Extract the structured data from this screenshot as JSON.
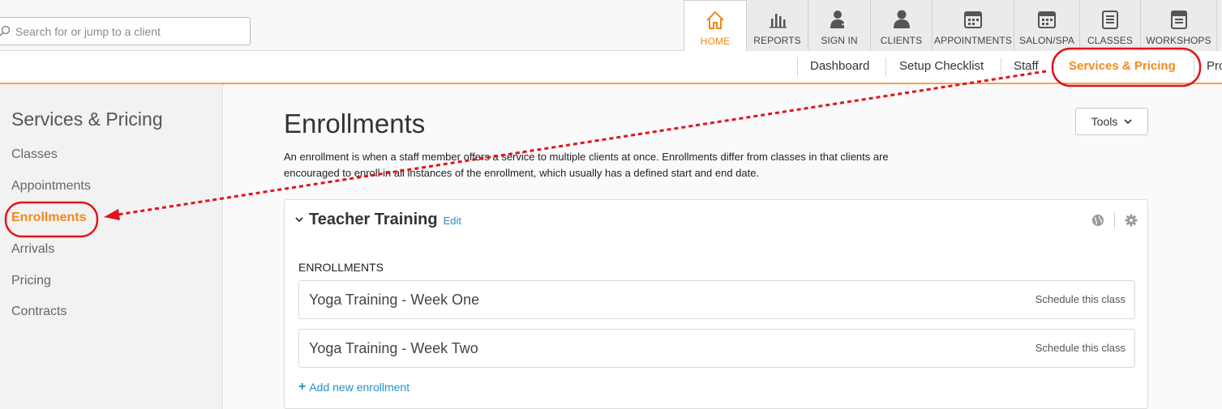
{
  "search": {
    "placeholder": "Search for or jump to a client"
  },
  "nav_tabs": [
    {
      "label": "HOME",
      "icon": "home-icon",
      "active": true
    },
    {
      "label": "REPORTS",
      "icon": "bar-chart-icon"
    },
    {
      "label": "SIGN IN",
      "icon": "user-sign-in-icon"
    },
    {
      "label": "CLIENTS",
      "icon": "user-icon"
    },
    {
      "label": "APPOINTMENTS",
      "icon": "calendar-icon"
    },
    {
      "label": "SALON/SPA",
      "icon": "calendar-icon"
    },
    {
      "label": "CLASSES",
      "icon": "list-icon"
    },
    {
      "label": "WORKSHOPS",
      "icon": "calendar-icon"
    }
  ],
  "subnav": {
    "items": [
      "Dashboard",
      "Setup Checklist",
      "Staff",
      "Services & Pricing",
      "Pro"
    ],
    "active": "Services & Pricing"
  },
  "sidebar": {
    "title": "Services & Pricing",
    "items": [
      "Classes",
      "Appointments",
      "Enrollments",
      "Arrivals",
      "Pricing",
      "Contracts"
    ],
    "active": "Enrollments"
  },
  "main": {
    "title": "Enrollments",
    "tools_label": "Tools",
    "description": "An enrollment is when a staff member offers a service to multiple clients at once. Enrollments differ from classes in that clients are encouraged to enroll in all instances of the enrollment, which usually has a defined start and end date.",
    "panel": {
      "title": "Teacher Training",
      "edit_label": "Edit",
      "section_label": "ENROLLMENTS",
      "enrollments": [
        {
          "name": "Yoga Training - Week One",
          "action": "Schedule this class"
        },
        {
          "name": "Yoga Training - Week Two",
          "action": "Schedule this class"
        }
      ],
      "add_label": "Add new enrollment"
    }
  },
  "colors": {
    "accent_orange": "#f08a1d",
    "link_blue": "#2a8fc9",
    "annotation_red": "#e0151c"
  }
}
